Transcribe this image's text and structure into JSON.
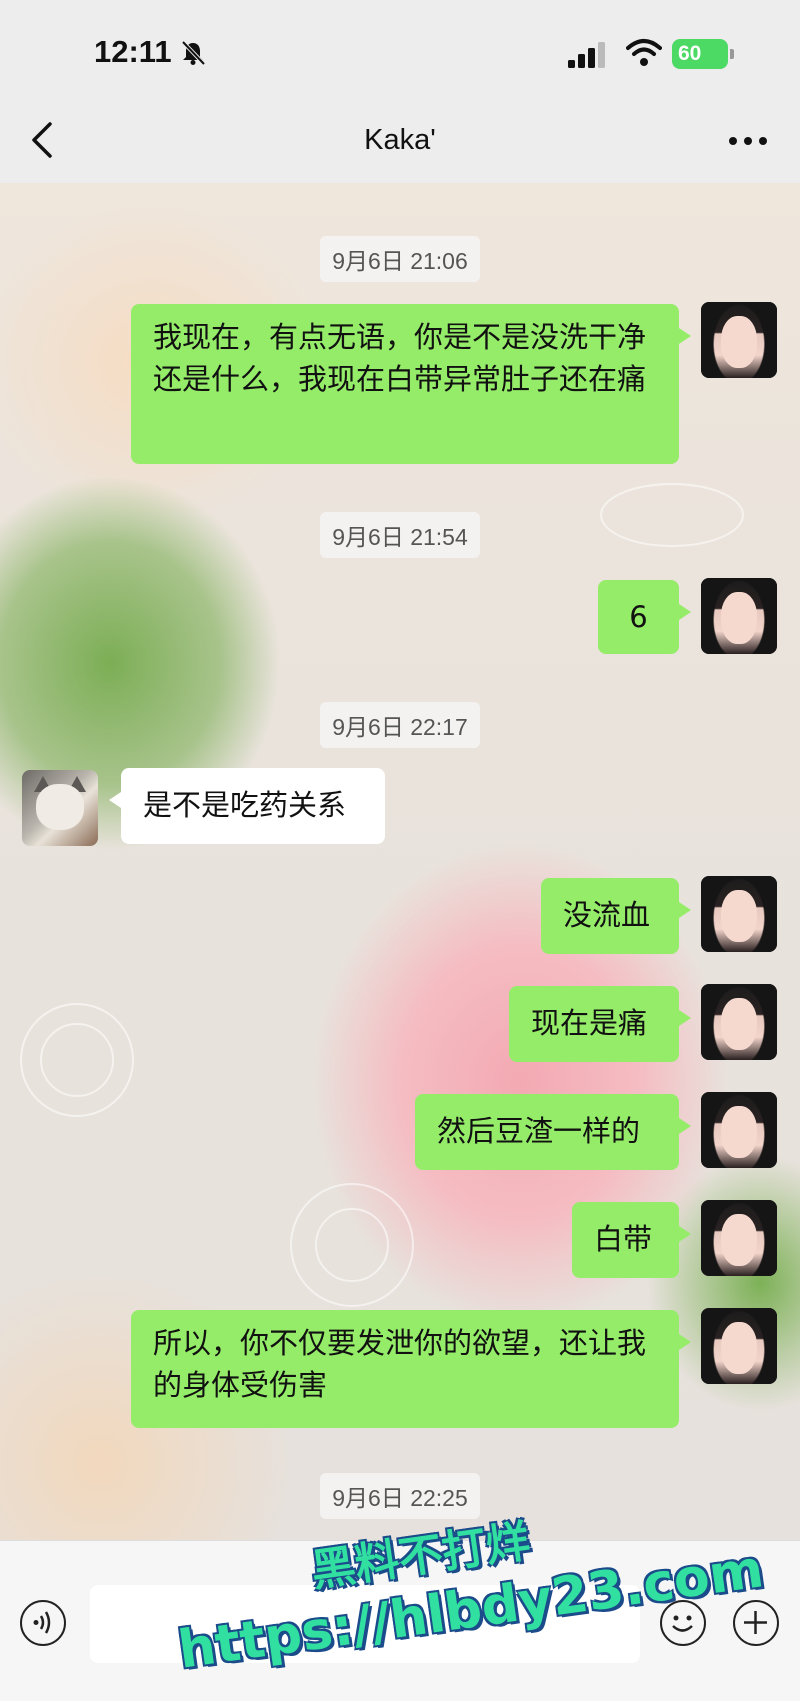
{
  "status_bar": {
    "time": "12:11",
    "battery": "60"
  },
  "header": {
    "title": "Kaka'"
  },
  "timestamps": [
    "9月6日 21:06",
    "9月6日 21:54",
    "9月6日 22:17",
    "9月6日 22:25"
  ],
  "messages": [
    {
      "sender": "me",
      "text": "我现在，有点无语，你是不是没洗干净还是什么，我现在白带异常肚子还在痛"
    },
    {
      "sender": "me",
      "text": "6"
    },
    {
      "sender": "them",
      "text": "是不是吃药关系"
    },
    {
      "sender": "me",
      "text": "没流血"
    },
    {
      "sender": "me",
      "text": "现在是痛"
    },
    {
      "sender": "me",
      "text": "然后豆渣一样的"
    },
    {
      "sender": "me",
      "text": "白带"
    },
    {
      "sender": "me",
      "text": "所以，你不仅要发泄你的欲望，还让我的身体受伤害"
    }
  ],
  "watermark": {
    "line1": "黑料不打烊",
    "line2": "https://hlbdy23.com"
  },
  "colors": {
    "my_bubble": "#95ec69",
    "their_bubble": "#ffffff",
    "header_bg": "#ededed"
  }
}
